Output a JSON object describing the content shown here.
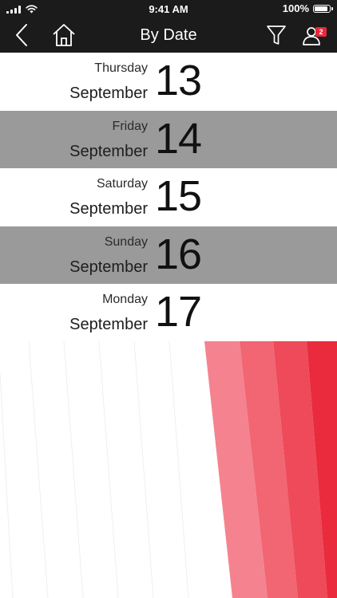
{
  "status_bar": {
    "time": "9:41 AM",
    "battery_label": "100%",
    "battery_level": 1.0,
    "icons": [
      "signal-icon",
      "wifi-icon",
      "battery-icon"
    ]
  },
  "nav": {
    "title": "By Date",
    "notification_count": "2",
    "icons": [
      "back-chevron-icon",
      "home-icon",
      "filter-icon",
      "person-icon"
    ]
  },
  "dates": [
    {
      "weekday": "Thursday",
      "month": "September",
      "day": "13",
      "shade": "light"
    },
    {
      "weekday": "Friday",
      "month": "September",
      "day": "14",
      "shade": "dark"
    },
    {
      "weekday": "Saturday",
      "month": "September",
      "day": "15",
      "shade": "light"
    },
    {
      "weekday": "Sunday",
      "month": "September",
      "day": "16",
      "shade": "dark"
    },
    {
      "weekday": "Monday",
      "month": "September",
      "day": "17",
      "shade": "light"
    }
  ],
  "colors": {
    "bar_background": "#1b1b1b",
    "row_dark": "#9a9a9a",
    "row_light": "#ffffff",
    "badge": "#e8283a",
    "stripe_1": "#f4838f",
    "stripe_2": "#f26572",
    "stripe_3": "#ee4a59",
    "stripe_4": "#ea2b3d"
  }
}
